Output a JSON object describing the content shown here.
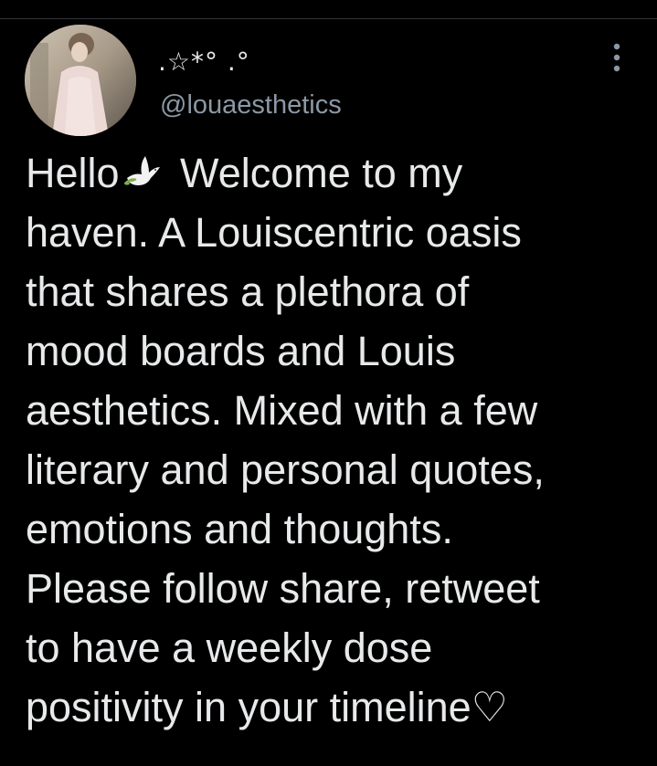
{
  "tweet": {
    "display_name": ".☆*° .°",
    "handle": "@louaesthetics",
    "text_before_icon": "Hello",
    "icon": "dove-icon",
    "text_after_icon": " Welcome to my\nhaven. A Louiscentric oasis\nthat shares a plethora of\nmood boards and Louis\naesthetics. Mixed with a few\nliterary and personal quotes,\nemotions and thoughts.\nPlease follow share, retweet\nto have a weekly dose\npositivity in your timeline♡",
    "more_icon": "more-vertical-icon"
  },
  "colors": {
    "background": "#000000",
    "text": "#e7e9ea",
    "secondary_text": "#8b98a5",
    "divider": "#2f3336"
  }
}
